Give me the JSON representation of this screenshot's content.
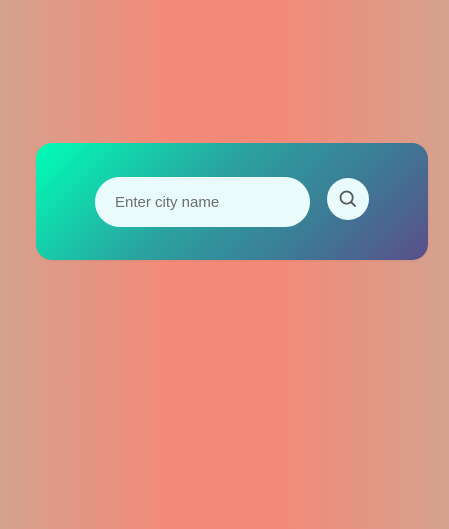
{
  "search": {
    "placeholder": "Enter city name",
    "value": ""
  },
  "icons": {
    "search_button": "search-icon"
  },
  "colors": {
    "background_center": "#f38a78",
    "background_edge": "#d4a28e",
    "card_gradient_start": "#00ffb6",
    "card_gradient_end": "#5a4f8a",
    "input_background": "#e9fbfb",
    "icon_color": "#555555"
  }
}
